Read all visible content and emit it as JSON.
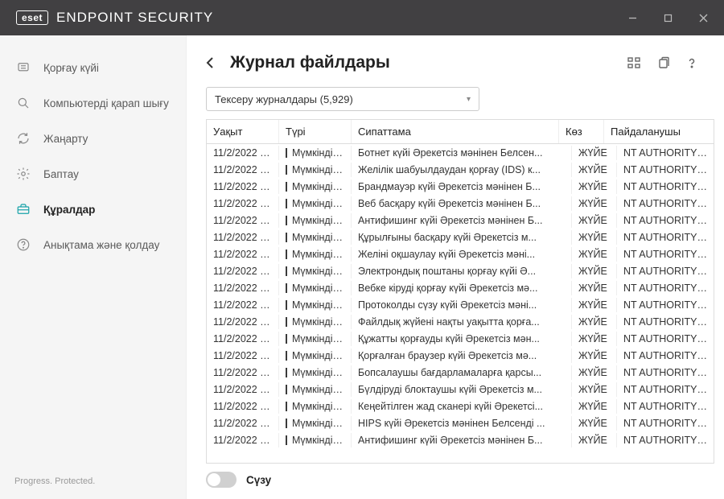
{
  "titlebar": {
    "logo": "eset",
    "title": "ENDPOINT SECURITY"
  },
  "sidebar": {
    "items": [
      {
        "label": "Қорғау күйі",
        "icon": "shield-icon"
      },
      {
        "label": "Компьютерді қарап шығу",
        "icon": "search-icon"
      },
      {
        "label": "Жаңарту",
        "icon": "refresh-icon"
      },
      {
        "label": "Баптау",
        "icon": "gear-icon"
      },
      {
        "label": "Құралдар",
        "icon": "toolbox-icon"
      },
      {
        "label": "Анықтама және қолдау",
        "icon": "help-icon"
      }
    ],
    "footer": "Progress. Protected."
  },
  "page": {
    "title": "Журнал файлдары",
    "dropdown": "Тексеру журналдары (5,929)",
    "filter_label": "Сүзу"
  },
  "table": {
    "headers": {
      "time": "Уақыт",
      "type": "Түрі",
      "desc": "Сипаттама",
      "source": "Көз",
      "user": "Пайдаланушы"
    },
    "rows": [
      {
        "time": "11/2/2022 8...",
        "type": "Мүмкіндік ө...",
        "desc": "Ботнет күйі Әрекетсіз мәнінен Белсен...",
        "source": "ЖҮЙЕ",
        "user": "NT AUTHORITY\\SY..."
      },
      {
        "time": "11/2/2022 8...",
        "type": "Мүмкіндік ө...",
        "desc": "Желілік шабуылдаудан қорғау (IDS) к...",
        "source": "ЖҮЙЕ",
        "user": "NT AUTHORITY\\SY..."
      },
      {
        "time": "11/2/2022 8...",
        "type": "Мүмкіндік ө...",
        "desc": "Брандмауэр күйі Әрекетсіз мәнінен Б...",
        "source": "ЖҮЙЕ",
        "user": "NT AUTHORITY\\SY..."
      },
      {
        "time": "11/2/2022 8...",
        "type": "Мүмкіндік ө...",
        "desc": "Веб басқару күйі Әрекетсіз мәнінен Б...",
        "source": "ЖҮЙЕ",
        "user": "NT AUTHORITY\\SY..."
      },
      {
        "time": "11/2/2022 8...",
        "type": "Мүмкіндік ө...",
        "desc": "Антифишинг күйі Әрекетсіз мәнінен Б...",
        "source": "ЖҮЙЕ",
        "user": "NT AUTHORITY\\SY..."
      },
      {
        "time": "11/2/2022 8...",
        "type": "Мүмкіндік ө...",
        "desc": "Құрылғыны басқару күйі Әрекетсіз м...",
        "source": "ЖҮЙЕ",
        "user": "NT AUTHORITY\\SY..."
      },
      {
        "time": "11/2/2022 8...",
        "type": "Мүмкіндік ө...",
        "desc": "Желіні оқшаулау күйі Әрекетсіз мәні...",
        "source": "ЖҮЙЕ",
        "user": "NT AUTHORITY\\SY..."
      },
      {
        "time": "11/2/2022 8...",
        "type": "Мүмкіндік ө...",
        "desc": "Электрондық поштаны қорғау күйі Ә...",
        "source": "ЖҮЙЕ",
        "user": "NT AUTHORITY\\SY..."
      },
      {
        "time": "11/2/2022 8...",
        "type": "Мүмкіндік ө...",
        "desc": "Вебке кіруді қорғау күйі Әрекетсіз мә...",
        "source": "ЖҮЙЕ",
        "user": "NT AUTHORITY\\SY..."
      },
      {
        "time": "11/2/2022 8...",
        "type": "Мүмкіндік ө...",
        "desc": "Протоколды сүзу күйі Әрекетсіз мәні...",
        "source": "ЖҮЙЕ",
        "user": "NT AUTHORITY\\SY..."
      },
      {
        "time": "11/2/2022 8...",
        "type": "Мүмкіндік ө...",
        "desc": "Файлдық жүйені нақты уақытта қорға...",
        "source": "ЖҮЙЕ",
        "user": "NT AUTHORITY\\SY..."
      },
      {
        "time": "11/2/2022 8...",
        "type": "Мүмкіндік ө...",
        "desc": "Құжатты қорғауды күйі Әрекетсіз мән...",
        "source": "ЖҮЙЕ",
        "user": "NT AUTHORITY\\SY..."
      },
      {
        "time": "11/2/2022 8...",
        "type": "Мүмкіндік ө...",
        "desc": "Қорғалған браузер күйі Әрекетсіз мә...",
        "source": "ЖҮЙЕ",
        "user": "NT AUTHORITY\\SY..."
      },
      {
        "time": "11/2/2022 8...",
        "type": "Мүмкіндік ө...",
        "desc": "Бопсалаушы бағдарламаларға қарсы...",
        "source": "ЖҮЙЕ",
        "user": "NT AUTHORITY\\SY..."
      },
      {
        "time": "11/2/2022 8...",
        "type": "Мүмкіндік ө...",
        "desc": "Бүлдіруді блоктаушы күйі Әрекетсіз м...",
        "source": "ЖҮЙЕ",
        "user": "NT AUTHORITY\\SY..."
      },
      {
        "time": "11/2/2022 8...",
        "type": "Мүмкіндік ө...",
        "desc": "Кеңейтілген жад сканері күйі Әрекетсі...",
        "source": "ЖҮЙЕ",
        "user": "NT AUTHORITY\\SY..."
      },
      {
        "time": "11/2/2022 8...",
        "type": "Мүмкіндік ө...",
        "desc": "HIPS күйі Әрекетсіз мәнінен Белсенді ...",
        "source": "ЖҮЙЕ",
        "user": "NT AUTHORITY\\SY..."
      },
      {
        "time": "11/2/2022 8...",
        "type": "Мүмкіндік ө...",
        "desc": "Антифишинг күйі Әрекетсіз мәнінен Б...",
        "source": "ЖҮЙЕ",
        "user": "NT AUTHORITY\\SY..."
      }
    ]
  }
}
